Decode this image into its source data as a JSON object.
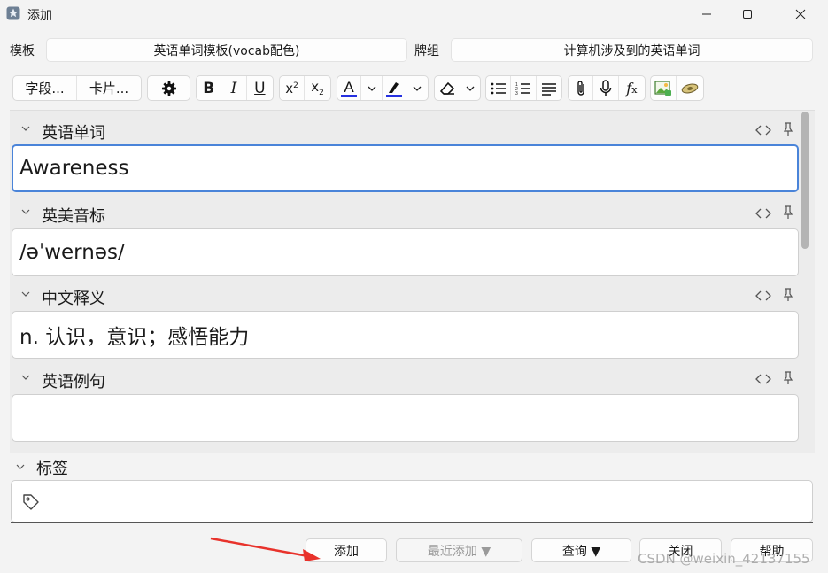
{
  "window": {
    "title": "添加",
    "controls": [
      "minimize-icon",
      "maximize-icon",
      "close-icon"
    ]
  },
  "selectors": {
    "note_type_label": "模板",
    "note_type_value": "英语单词模板(vocab配色)",
    "deck_label": "牌组",
    "deck_value": "计算机涉及到的英语单词"
  },
  "toolbar": {
    "fields_button": "字段...",
    "cards_button": "卡片...",
    "icons": [
      "gear-icon",
      "bold-icon",
      "italic-icon",
      "underline-icon",
      "superscript-icon",
      "subscript-icon",
      "text-color-icon",
      "highlight-icon",
      "eraser-icon",
      "bullet-list-icon",
      "numbered-list-icon",
      "align-icon",
      "attachment-icon",
      "microphone-icon",
      "formula-icon",
      "image-occlusion-icon",
      "eye-icon"
    ],
    "colors": {
      "text_color": "#2530e0",
      "highlight_color": "#2530e0"
    }
  },
  "fields": [
    {
      "name": "英语单词",
      "value": "Awareness",
      "focused": true
    },
    {
      "name": "英美音标",
      "value": "/əˈwernəs/",
      "focused": false
    },
    {
      "name": "中文释义",
      "value": "n. 认识，意识；感悟能力",
      "focused": false
    },
    {
      "name": "英语例句",
      "value": "",
      "focused": false
    }
  ],
  "tags": {
    "label": "标签",
    "value": ""
  },
  "buttons": {
    "add": "添加",
    "history": "最近添加 ▼",
    "browse": "查询 ▼",
    "close": "关闭",
    "help": "帮助"
  },
  "watermark": "CSDN @weixin_42137155",
  "colors": {
    "focus_border": "#4a84d9",
    "annotation_arrow": "#e8322b"
  }
}
